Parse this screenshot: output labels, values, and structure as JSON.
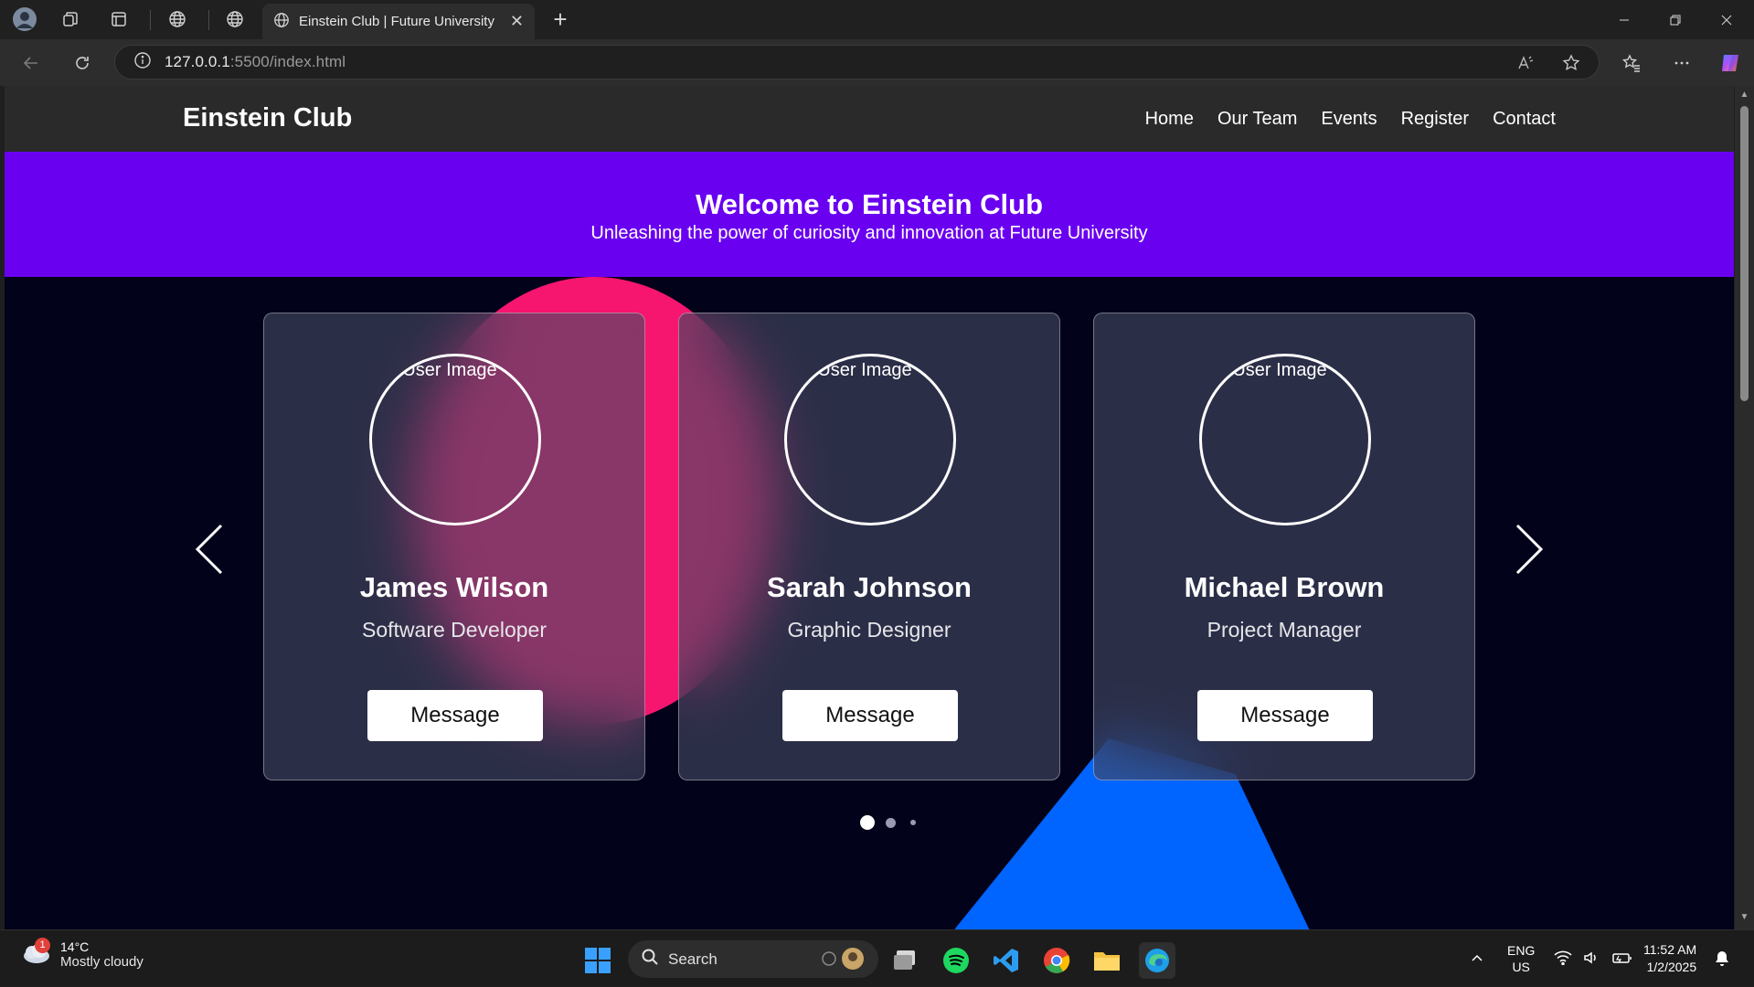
{
  "browser": {
    "tab_title": "Einstein Club | Future University",
    "url_host": "127.0.0.1",
    "url_rest": ":5500/index.html"
  },
  "site": {
    "logo": "Einstein Club",
    "nav": [
      "Home",
      "Our Team",
      "Events",
      "Register",
      "Contact"
    ],
    "hero_title": "Welcome to Einstein Club",
    "hero_subtitle": "Unleashing the power of curiosity and innovation at Future University"
  },
  "team": {
    "members": [
      {
        "image_alt": "User Image",
        "name": "James Wilson",
        "role": "Software Developer",
        "button": "Message"
      },
      {
        "image_alt": "User Image",
        "name": "Sarah Johnson",
        "role": "Graphic Designer",
        "button": "Message"
      },
      {
        "image_alt": "User Image",
        "name": "Michael Brown",
        "role": "Project Manager",
        "button": "Message"
      }
    ],
    "active_dot": 1,
    "dot_count": 3
  },
  "taskbar": {
    "weather_temp": "14°C",
    "weather_desc": "Mostly cloudy",
    "weather_badge": "1",
    "search_label": "Search",
    "lang_top": "ENG",
    "lang_bottom": "US",
    "time": "11:52 AM",
    "date": "1/2/2025"
  },
  "colors": {
    "hero": "#6a00f0",
    "page_bg": "#02021a",
    "pink_blob": "#f6166f",
    "blue_blob": "#0064ff"
  }
}
